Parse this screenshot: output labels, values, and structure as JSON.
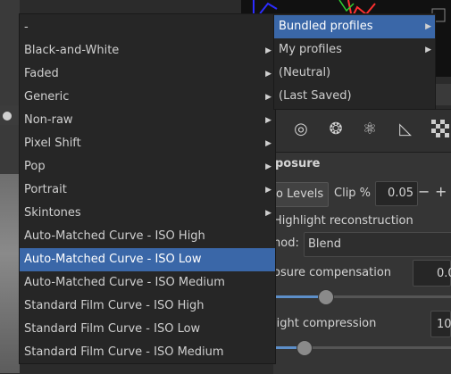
{
  "profiles_menu": {
    "items": [
      {
        "label": "Bundled profiles",
        "submenu": true,
        "selected": true
      },
      {
        "label": "My profiles",
        "submenu": true,
        "selected": false
      },
      {
        "label": "(Neutral)",
        "submenu": false,
        "selected": false
      },
      {
        "label": "(Last Saved)",
        "submenu": false,
        "selected": false
      }
    ]
  },
  "bundled_menu": {
    "items": [
      {
        "label": "-",
        "submenu": false,
        "selected": false
      },
      {
        "label": "Black-and-White",
        "submenu": true,
        "selected": false
      },
      {
        "label": "Faded",
        "submenu": true,
        "selected": false
      },
      {
        "label": "Generic",
        "submenu": true,
        "selected": false
      },
      {
        "label": "Non-raw",
        "submenu": true,
        "selected": false
      },
      {
        "label": "Pixel Shift",
        "submenu": true,
        "selected": false
      },
      {
        "label": "Pop",
        "submenu": true,
        "selected": false
      },
      {
        "label": "Portrait",
        "submenu": true,
        "selected": false
      },
      {
        "label": "Skintones",
        "submenu": true,
        "selected": false
      },
      {
        "label": "Auto-Matched Curve - ISO High",
        "submenu": false,
        "selected": false
      },
      {
        "label": "Auto-Matched Curve - ISO Low",
        "submenu": false,
        "selected": true
      },
      {
        "label": "Auto-Matched Curve - ISO Medium",
        "submenu": false,
        "selected": false
      },
      {
        "label": "Standard Film Curve - ISO High",
        "submenu": false,
        "selected": false
      },
      {
        "label": "Standard Film Curve - ISO Low",
        "submenu": false,
        "selected": false
      },
      {
        "label": "Standard Film Curve - ISO Medium",
        "submenu": false,
        "selected": false
      }
    ]
  },
  "exposure": {
    "title": "posure",
    "auto_levels_label": "o Levels",
    "clip_label": "Clip %",
    "clip_value": "0.05",
    "minus_label": "−",
    "plus_label": "+",
    "highlight_reconstruction_label": "Highlight reconstruction",
    "method_label": "hod:",
    "method_value": "Blend",
    "exposure_compensation_label": "osure compensation",
    "exposure_compensation_value": "0.0",
    "exposure_slider_fraction": 0.29,
    "highlight_compression_label": "light compression",
    "highlight_compression_value": "10",
    "highlight_slider_fraction": 0.17
  },
  "colors": {
    "selected": "#3a67a8",
    "menu_bg": "#262626",
    "accent": "#5d8fc9"
  },
  "icons": [
    "circle-target-icon",
    "color-circles-icon",
    "atom-icon",
    "ruler-triangle-icon",
    "checkerboard-icon"
  ]
}
